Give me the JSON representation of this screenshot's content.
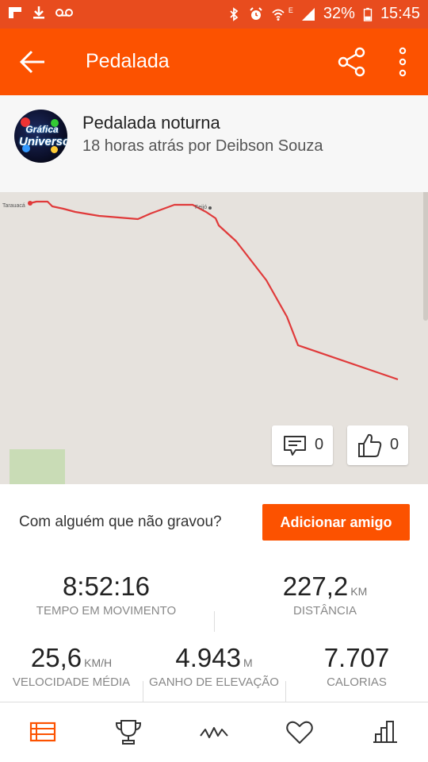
{
  "status_bar": {
    "battery_percent": "32%",
    "time": "15:45",
    "network_letter": "E",
    "left_icons": [
      "flipboard-icon",
      "download-icon",
      "voicemail-icon"
    ],
    "right_icons": [
      "bluetooth-icon",
      "alarm-icon",
      "wifi-icon",
      "signal-icon",
      "battery-icon"
    ]
  },
  "app_bar": {
    "title": "Pedalada",
    "back_icon": "arrow-back-icon",
    "share_icon": "share-icon",
    "menu_icon": "more-vert-icon",
    "color": "#fc5200"
  },
  "activity": {
    "title": "Pedalada noturna",
    "subtitle": "18 horas atrás por Deibson Souza",
    "avatar_text_1": "Gráfica",
    "avatar_text_2": "Universo"
  },
  "map": {
    "places": [
      "Tarauacá",
      "Feijó"
    ],
    "route_color": "#e03a3a",
    "comments_count": "0",
    "kudos_count": "0"
  },
  "invite": {
    "prompt": "Com alguém que não gravou?",
    "button_label": "Adicionar amigo"
  },
  "stats": {
    "moving_time": {
      "value": "8:52:16",
      "unit": "",
      "label": "TEMPO EM MOVIMENTO"
    },
    "distance": {
      "value": "227,2",
      "unit": "KM",
      "label": "DISTÂNCIA"
    },
    "avg_speed": {
      "value": "25,6",
      "unit": "KM/H",
      "label": "VELOCIDADE MÉDIA"
    },
    "elevation_gain": {
      "value": "4.943",
      "unit": "M",
      "label": "GANHO DE ELEVAÇÃO"
    },
    "calories": {
      "value": "7.707",
      "unit": "",
      "label": "CALORIAS"
    }
  },
  "bottom_nav": {
    "items": [
      "feed-icon",
      "trophy-icon",
      "activity-graph-icon",
      "heart-icon",
      "stats-bars-icon"
    ],
    "active_color": "#fc5200"
  }
}
